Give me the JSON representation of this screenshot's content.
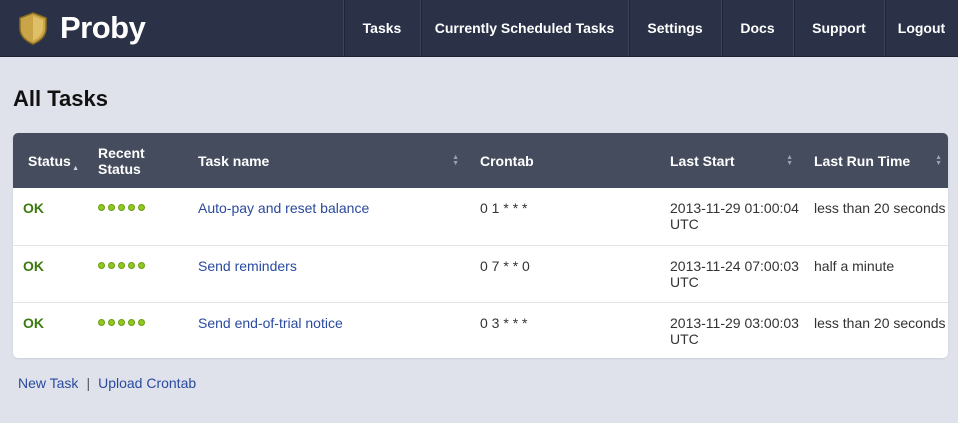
{
  "brand": {
    "name": "Proby",
    "logo_icon": "shield-icon"
  },
  "nav": [
    "Tasks",
    "Currently Scheduled Tasks",
    "Settings",
    "Docs",
    "Support",
    "Logout"
  ],
  "page_title": "All Tasks",
  "table": {
    "headers": [
      "Status",
      "Recent Status",
      "Task name",
      "Crontab",
      "Last Start",
      "Last Run Time"
    ],
    "rows": [
      {
        "status": "OK",
        "recent": [
          "success",
          "success",
          "success",
          "success",
          "success"
        ],
        "name": "Auto-pay and reset balance",
        "crontab": "0 1 * * *",
        "last_start": "2013-11-29 01:00:04 UTC",
        "run_time": "less than 20 seconds"
      },
      {
        "status": "OK",
        "recent": [
          "success",
          "success",
          "success",
          "success",
          "success"
        ],
        "name": "Send reminders",
        "crontab": "0 7 * * 0",
        "last_start": "2013-11-24 07:00:03 UTC",
        "run_time": "half a minute"
      },
      {
        "status": "OK",
        "recent": [
          "success",
          "success",
          "success",
          "success",
          "success"
        ],
        "name": "Send end-of-trial notice",
        "crontab": "0 3 * * *",
        "last_start": "2013-11-29 03:00:03 UTC",
        "run_time": "less than 20 seconds"
      }
    ]
  },
  "footer": {
    "new_task": "New Task",
    "separator": "|",
    "upload_crontab": "Upload Crontab"
  },
  "colors": {
    "navbar": "#2b3247",
    "header": "#454c5e",
    "ok": "#3b7a0e",
    "dot": "#8fc91f",
    "link": "#2a4a9f"
  }
}
